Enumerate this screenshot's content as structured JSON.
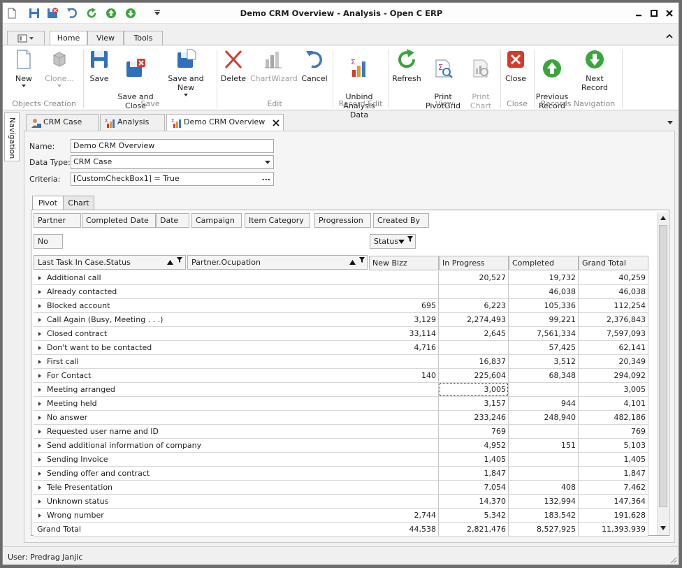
{
  "window": {
    "title": "Demo CRM Overview - Analysis - Open C ERP"
  },
  "ribbon_tabs": [
    {
      "label": "Home"
    },
    {
      "label": "View"
    },
    {
      "label": "Tools"
    }
  ],
  "ribbon": {
    "buttons": {
      "new": "New",
      "clone": "Clone...",
      "save": "Save",
      "save_close": "Save and\nClose",
      "save_new": "Save and New",
      "delete": "Delete",
      "chartwizard": "ChartWizard",
      "cancel": "Cancel",
      "unbind": "Unbind\nAnalysis Data",
      "refresh": "Refresh",
      "print_pivot": "Print\nPivotGrid",
      "print_chart": "Print\nChart",
      "close": "Close",
      "prev_record": "Previous\nRecord",
      "next_record": "Next Record"
    },
    "groups": {
      "objects_creation": "Objects Creation",
      "save": "Save",
      "edit": "Edit",
      "record_edit": "Record Edit",
      "view": "View",
      "close": "Close",
      "records_navigation": "Records Navigation"
    }
  },
  "navigation_label": "Navigation",
  "doc_tabs": [
    {
      "label": "CRM Case",
      "icon": "crm-case-icon"
    },
    {
      "label": "Analysis",
      "icon": "analysis-icon"
    },
    {
      "label": "Demo CRM Overview - ...",
      "icon": "analysis-icon"
    }
  ],
  "form": {
    "name_label": "Name:",
    "name_value": "Demo CRM Overview",
    "datatype_label": "Data Type:",
    "datatype_value": "CRM Case",
    "criteria_label": "Criteria:",
    "criteria_value": "[CustomCheckBox1] = True",
    "criteria_button": "..."
  },
  "pivot_tabs": [
    {
      "label": "Pivot"
    },
    {
      "label": "Chart"
    }
  ],
  "pivot": {
    "filter_fields": [
      "Partner",
      "Completed Date",
      "Date",
      "Campaign",
      "Item Category",
      "Progression",
      "Created By"
    ],
    "data_field": "No",
    "column_field": "Status",
    "row_fields": [
      "Last Task In Case.Status",
      "Partner.Ocupation"
    ],
    "columns": [
      "New Bizz",
      "In Progress",
      "Completed",
      "Grand Total"
    ],
    "rows": [
      {
        "label": "Additional call",
        "values": [
          "",
          "20,527",
          "19,732",
          "40,259"
        ]
      },
      {
        "label": "Already contacted",
        "values": [
          "",
          "",
          "46,038",
          "46,038"
        ]
      },
      {
        "label": "Blocked account",
        "values": [
          "695",
          "6,223",
          "105,336",
          "112,254"
        ]
      },
      {
        "label": "Call Again (Busy, Meeting . . .)",
        "values": [
          "3,129",
          "2,274,493",
          "99,221",
          "2,376,843"
        ]
      },
      {
        "label": "Closed contract",
        "values": [
          "33,114",
          "2,645",
          "7,561,334",
          "7,597,093"
        ]
      },
      {
        "label": "Don't want to be contacted",
        "values": [
          "4,716",
          "",
          "57,425",
          "62,141"
        ]
      },
      {
        "label": "First call",
        "values": [
          "",
          "16,837",
          "3,512",
          "20,349"
        ]
      },
      {
        "label": "For Contact",
        "values": [
          "140",
          "225,604",
          "68,348",
          "294,092"
        ]
      },
      {
        "label": "Meeting arranged",
        "values": [
          "",
          "3,005",
          "",
          "3,005"
        ]
      },
      {
        "label": "Meeting held",
        "values": [
          "",
          "3,157",
          "944",
          "4,101"
        ]
      },
      {
        "label": "No answer",
        "values": [
          "",
          "233,246",
          "248,940",
          "482,186"
        ]
      },
      {
        "label": "Requested user name and ID",
        "values": [
          "",
          "769",
          "",
          "769"
        ]
      },
      {
        "label": "Send additional information of company",
        "values": [
          "",
          "4,952",
          "151",
          "5,103"
        ]
      },
      {
        "label": "Sending Invoice",
        "values": [
          "",
          "1,405",
          "",
          "1,405"
        ]
      },
      {
        "label": "Sending offer and contract",
        "values": [
          "",
          "1,847",
          "",
          "1,847"
        ]
      },
      {
        "label": "Tele Presentation",
        "values": [
          "",
          "7,054",
          "408",
          "7,462"
        ]
      },
      {
        "label": "Unknown status",
        "values": [
          "",
          "14,370",
          "132,994",
          "147,364"
        ]
      },
      {
        "label": "Wrong number",
        "values": [
          "2,744",
          "5,342",
          "183,542",
          "191,628"
        ]
      }
    ],
    "grand_total_label": "Grand Total",
    "grand_total_values": [
      "44,538",
      "2,821,476",
      "8,527,925",
      "11,393,939"
    ]
  },
  "status_bar": {
    "user": "User: Predrag Janjic"
  },
  "colors": {
    "accent_green": "#3aa53a",
    "accent_red": "#d83a2a",
    "accent_blue": "#3b78c4"
  }
}
